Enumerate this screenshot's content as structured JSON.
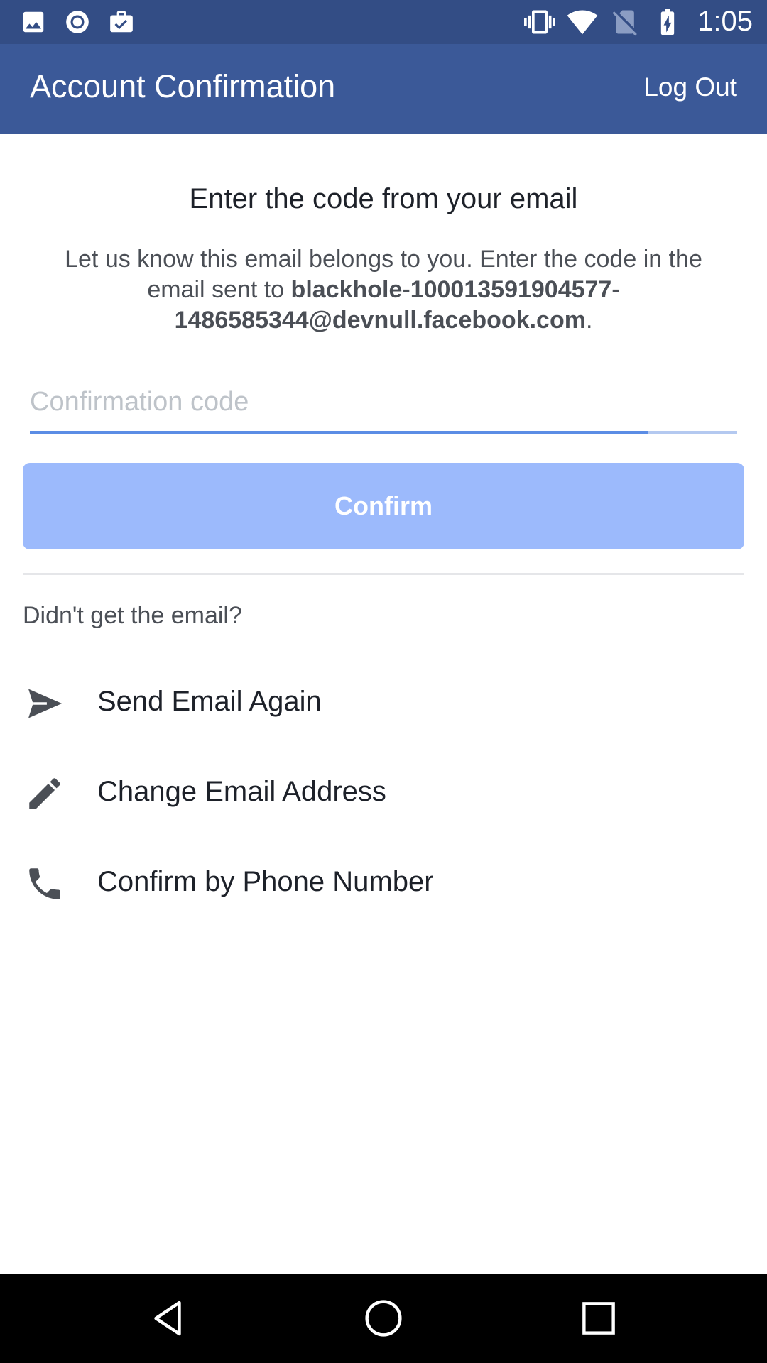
{
  "status_bar": {
    "time": "1:05",
    "left_icons": [
      "image-icon",
      "record-icon",
      "briefcase-check-icon"
    ],
    "right_icons": [
      "vibrate-icon",
      "wifi-icon",
      "no-sim-icon",
      "battery-charging-icon"
    ]
  },
  "app_bar": {
    "title": "Account Confirmation",
    "logout_label": "Log Out",
    "color": "#3b5998"
  },
  "main": {
    "heading": "Enter the code from your email",
    "desc_prefix": "Let us know this email belongs to you. Enter the code in the email sent to ",
    "email": "blackhole-100013591904577-1486585344@devnull.facebook.com",
    "desc_suffix": ".",
    "code_input": {
      "placeholder": "Confirmation code",
      "value": ""
    },
    "confirm_label": "Confirm",
    "confirm_color": "#9cbafc"
  },
  "help": {
    "prompt": "Didn't get the email?",
    "options": [
      {
        "label": "Send Email Again",
        "icon": "send-icon"
      },
      {
        "label": "Change Email Address",
        "icon": "pencil-icon"
      },
      {
        "label": "Confirm by Phone Number",
        "icon": "phone-icon"
      }
    ]
  },
  "nav_bar": {
    "buttons": [
      "back-icon",
      "home-icon",
      "recents-icon"
    ]
  }
}
